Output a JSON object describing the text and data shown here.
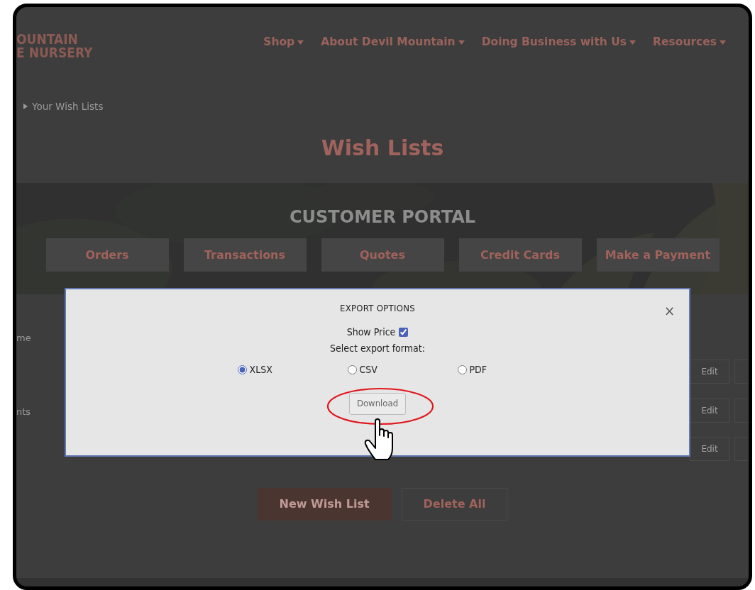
{
  "header": {
    "logo_lines": [
      "OUNTAIN",
      "E NURSERY"
    ],
    "nav": [
      {
        "label": "Shop"
      },
      {
        "label": "About Devil Mountain"
      },
      {
        "label": "Doing Business with Us"
      },
      {
        "label": "Resources"
      }
    ]
  },
  "breadcrumb": [
    "Your Wish Lists"
  ],
  "page_title": "Wish Lists",
  "portal": {
    "title": "CUSTOMER PORTAL",
    "buttons": [
      "Orders",
      "Transactions",
      "Quotes",
      "Credit Cards",
      "Make a Payment"
    ]
  },
  "wish_lists": {
    "header": "me",
    "rows": [
      {
        "edit": "Edit"
      },
      {
        "name": "nts",
        "edit": "Edit"
      },
      {
        "edit": "Edit"
      }
    ]
  },
  "actions": [
    {
      "label": "New Wish List",
      "kind": "primary"
    },
    {
      "label": "Delete All",
      "kind": "outline"
    }
  ],
  "modal": {
    "title": "EXPORT OPTIONS",
    "close": "×",
    "show_price": {
      "label": "Show Price",
      "checked": true
    },
    "format_label": "Select export format:",
    "formats": [
      {
        "label": "XLSX",
        "selected": true
      },
      {
        "label": "CSV",
        "selected": false
      },
      {
        "label": "PDF",
        "selected": false
      }
    ],
    "download": "Download"
  }
}
